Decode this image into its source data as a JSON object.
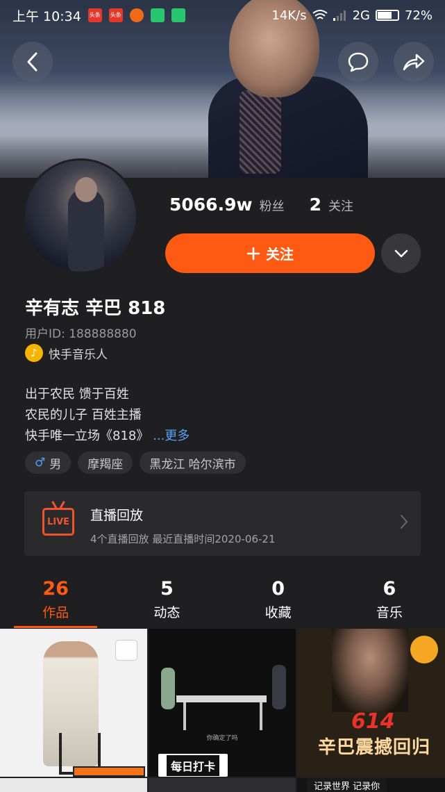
{
  "status_bar": {
    "time": "上午 10:34",
    "app_badge_1": "头条",
    "app_badge_2": "头条",
    "network_speed": "14K/s",
    "network_type": "2G",
    "battery": "72%",
    "battery_level": 0.72
  },
  "profile": {
    "fans_count": "5066.9w",
    "fans_label": "粉丝",
    "following_count": "2",
    "following_label": "关注",
    "follow_button": "关注",
    "name": "辛有志 辛巴 818",
    "user_id": "用户ID: 188888880",
    "badge_label": "快手音乐人",
    "bio_lines": [
      "出于农民 馈于百姓",
      "农民的儿子  百姓主播",
      "快手唯一立场《818》"
    ],
    "bio_more": "...更多",
    "tags": {
      "gender": "男",
      "zodiac": "摩羯座",
      "location": "黑龙江 哈尔滨市"
    }
  },
  "live_replay": {
    "icon_text": "LIVE",
    "title": "直播回放",
    "subtitle": "4个直播回放 最近直播时间2020-06-21"
  },
  "tabs": [
    {
      "count": "26",
      "label": "作品",
      "active": true
    },
    {
      "count": "5",
      "label": "动态",
      "active": false
    },
    {
      "count": "0",
      "label": "收藏",
      "active": false
    },
    {
      "count": "6",
      "label": "音乐",
      "active": false
    }
  ],
  "grid": {
    "item2_caption": "你确定了吗",
    "item2_tag": "每日打卡",
    "item3_date": "614",
    "item3_title": "辛巴震撼回归",
    "item3_bottom": "记录世界 记录你"
  },
  "colors": {
    "accent": "#fe5a14",
    "background": "#1f1f21",
    "link": "#5aa0f0",
    "live": "#f0542e"
  }
}
